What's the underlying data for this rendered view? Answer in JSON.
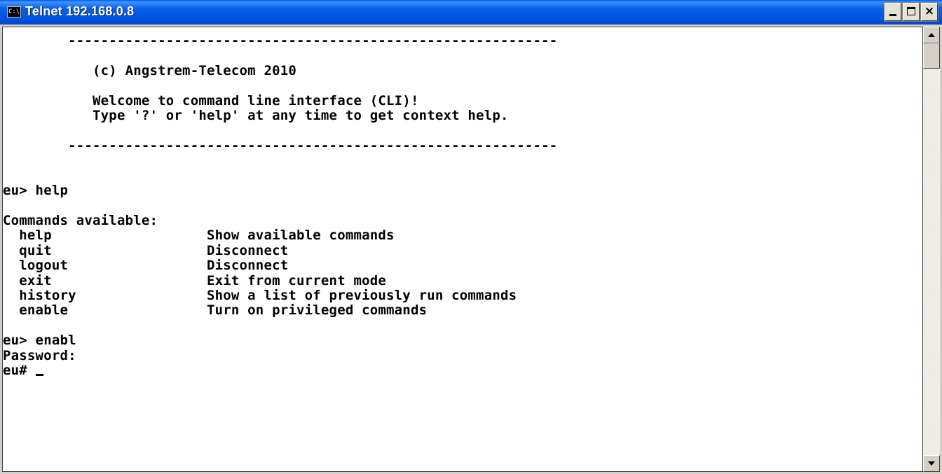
{
  "window": {
    "title": "Telnet 192.168.0.8",
    "icon_label": "C:\\",
    "buttons": {
      "minimize": "minimize",
      "maximize": "maximize",
      "close": "×"
    }
  },
  "console": {
    "lines": [
      "        ------------------------------------------------------------",
      "",
      "           (c) Angstrem-Telecom 2010",
      "",
      "           Welcome to command line interface (CLI)!",
      "           Type '?' or 'help' at any time to get context help.",
      "",
      "        ------------------------------------------------------------",
      "",
      "",
      "eu> help",
      "",
      "Commands available:",
      "  help                   Show available commands",
      "  quit                   Disconnect",
      "  logout                 Disconnect",
      "  exit                   Exit from current mode",
      "  history                Show a list of previously run commands",
      "  enable                 Turn on privileged commands",
      "",
      "eu> enabl",
      "Password:",
      "eu# "
    ]
  },
  "colors": {
    "titlebar": "#0055E5",
    "console_bg": "#FFFFFF",
    "console_fg": "#000000"
  },
  "icons": [
    "console-icon",
    "minimize-icon",
    "maximize-icon",
    "close-icon",
    "scroll-up-icon",
    "scroll-down-icon"
  ]
}
